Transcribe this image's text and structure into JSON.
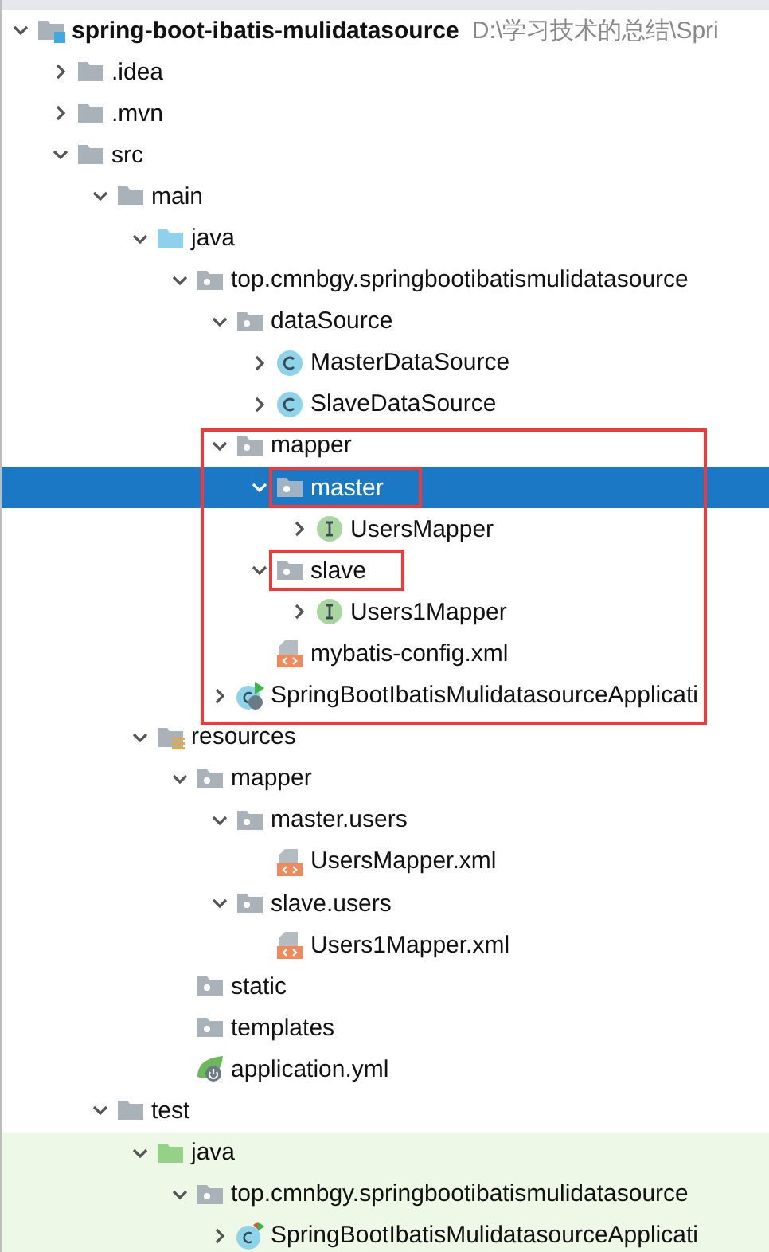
{
  "project": {
    "label": "spring-boot-ibatis-mulidatasource",
    "path": "D:\\学习技术的总结\\Spri",
    "kind": "module",
    "expanded": true,
    "selected": false,
    "boxed": false,
    "group_boxed": false,
    "children": [
      {
        "label": ".idea",
        "kind": "folder",
        "expanded": false,
        "selected": false,
        "boxed": false,
        "group_boxed": false
      },
      {
        "label": ".mvn",
        "kind": "folder",
        "expanded": false,
        "selected": false,
        "boxed": false,
        "group_boxed": false
      },
      {
        "label": "src",
        "kind": "folder",
        "expanded": true,
        "selected": false,
        "boxed": false,
        "group_boxed": false,
        "children": [
          {
            "label": "main",
            "kind": "folder",
            "expanded": true,
            "selected": false,
            "boxed": false,
            "group_boxed": false,
            "children": [
              {
                "label": "java",
                "kind": "source-folder",
                "expanded": true,
                "selected": false,
                "boxed": false,
                "group_boxed": false,
                "children": [
                  {
                    "label": "top.cmnbgy.springbootibatismulidatasource",
                    "kind": "package",
                    "expanded": true,
                    "selected": false,
                    "boxed": false,
                    "group_boxed": false,
                    "children": [
                      {
                        "label": "dataSource",
                        "kind": "package",
                        "expanded": true,
                        "selected": false,
                        "boxed": false,
                        "group_boxed": false,
                        "children": [
                          {
                            "label": "MasterDataSource",
                            "kind": "class",
                            "expanded": false,
                            "selected": false,
                            "boxed": false,
                            "group_boxed": false
                          },
                          {
                            "label": "SlaveDataSource",
                            "kind": "class",
                            "expanded": false,
                            "selected": false,
                            "boxed": false,
                            "group_boxed": false
                          }
                        ]
                      },
                      {
                        "label": "mapper",
                        "kind": "package",
                        "expanded": true,
                        "selected": false,
                        "boxed": false,
                        "group_boxed": true,
                        "children": [
                          {
                            "label": "master",
                            "kind": "package",
                            "expanded": true,
                            "selected": true,
                            "boxed": true,
                            "group_boxed": false,
                            "children": [
                              {
                                "label": "UsersMapper",
                                "kind": "interface",
                                "expanded": false,
                                "selected": false,
                                "boxed": false,
                                "group_boxed": false
                              }
                            ]
                          },
                          {
                            "label": "slave",
                            "kind": "package",
                            "expanded": true,
                            "selected": false,
                            "boxed": true,
                            "group_boxed": false,
                            "children": [
                              {
                                "label": "Users1Mapper",
                                "kind": "interface",
                                "expanded": false,
                                "selected": false,
                                "boxed": false,
                                "group_boxed": false
                              }
                            ]
                          },
                          {
                            "label": "mybatis-config.xml",
                            "kind": "xml",
                            "selected": false,
                            "boxed": false,
                            "group_boxed": false
                          }
                        ]
                      },
                      {
                        "label": "SpringBootIbatisMulidatasourceApplicati",
                        "kind": "spring-app",
                        "expanded": false,
                        "selected": false,
                        "boxed": false,
                        "group_boxed": true
                      }
                    ]
                  }
                ]
              },
              {
                "label": "resources",
                "kind": "resources-folder",
                "expanded": true,
                "selected": false,
                "boxed": false,
                "group_boxed": false,
                "children": [
                  {
                    "label": "mapper",
                    "kind": "package",
                    "expanded": true,
                    "selected": false,
                    "boxed": false,
                    "group_boxed": false,
                    "children": [
                      {
                        "label": "master.users",
                        "kind": "package",
                        "expanded": true,
                        "selected": false,
                        "boxed": false,
                        "group_boxed": false,
                        "children": [
                          {
                            "label": "UsersMapper.xml",
                            "kind": "xml",
                            "selected": false,
                            "boxed": false,
                            "group_boxed": false
                          }
                        ]
                      },
                      {
                        "label": "slave.users",
                        "kind": "package",
                        "expanded": true,
                        "selected": false,
                        "boxed": false,
                        "group_boxed": false,
                        "children": [
                          {
                            "label": "Users1Mapper.xml",
                            "kind": "xml",
                            "selected": false,
                            "boxed": false,
                            "group_boxed": false
                          }
                        ]
                      }
                    ]
                  },
                  {
                    "label": "static",
                    "kind": "package",
                    "selected": false,
                    "boxed": false,
                    "group_boxed": false
                  },
                  {
                    "label": "templates",
                    "kind": "package",
                    "selected": false,
                    "boxed": false,
                    "group_boxed": false
                  },
                  {
                    "label": "application.yml",
                    "kind": "spring-config",
                    "selected": false,
                    "boxed": false,
                    "group_boxed": false
                  }
                ]
              }
            ]
          },
          {
            "label": "test",
            "kind": "folder",
            "expanded": true,
            "selected": false,
            "boxed": false,
            "group_boxed": false,
            "children": [
              {
                "label": "java",
                "kind": "test-folder",
                "expanded": true,
                "selected": false,
                "boxed": false,
                "group_boxed": false,
                "children": [
                  {
                    "label": "top.cmnbgy.springbootibatismulidatasource",
                    "kind": "package",
                    "expanded": true,
                    "selected": false,
                    "boxed": false,
                    "group_boxed": false,
                    "children": [
                      {
                        "label": "SpringBootIbatisMulidatasourceApplicati",
                        "kind": "spring-test",
                        "expanded": false,
                        "selected": false,
                        "boxed": false,
                        "group_boxed": false
                      }
                    ]
                  }
                ]
              }
            ]
          }
        ]
      }
    ]
  }
}
